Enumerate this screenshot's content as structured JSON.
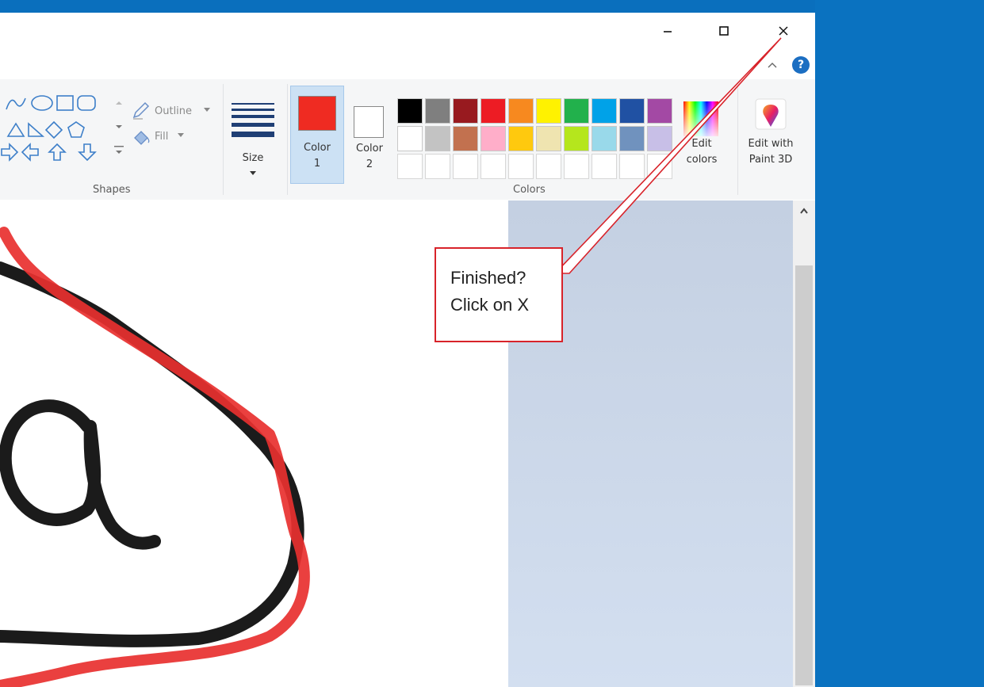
{
  "window": {
    "controls": {
      "minimize_glyph": "–",
      "maximize_glyph": "☐",
      "close_glyph": "✕"
    },
    "help_glyph": "?"
  },
  "ribbon": {
    "shapes": {
      "outline_label": "Outline",
      "fill_label": "Fill",
      "group_label": "Shapes"
    },
    "size": {
      "label": "Size"
    },
    "color1": {
      "label_line1": "Color",
      "label_line2": "1",
      "color": "#ef2b22"
    },
    "color2": {
      "label_line1": "Color",
      "label_line2": "2",
      "color": "#ffffff"
    },
    "palette_row1": [
      "#000000",
      "#7f7f7f",
      "#981a1f",
      "#ed1c24",
      "#f7891f",
      "#fff200",
      "#22b14c",
      "#00a2e8",
      "#2051a3",
      "#a349a4"
    ],
    "palette_row2": [
      "#ffffff",
      "#c3c3c3",
      "#c2714f",
      "#ffaec9",
      "#ffc90e",
      "#efe4b0",
      "#b5e61d",
      "#99d9ea",
      "#7092be",
      "#c8bfe7"
    ],
    "edit_colors": {
      "line1": "Edit",
      "line2": "colors"
    },
    "colors_group_label": "Colors",
    "paint3d": {
      "line1": "Edit with",
      "line2": "Paint 3D"
    }
  },
  "callout": {
    "line1": "Finished?",
    "line2": "Click on X",
    "border_color": "#d8232a"
  },
  "strokes": {
    "black": "#1b1b1b",
    "red": "#e8302f"
  }
}
